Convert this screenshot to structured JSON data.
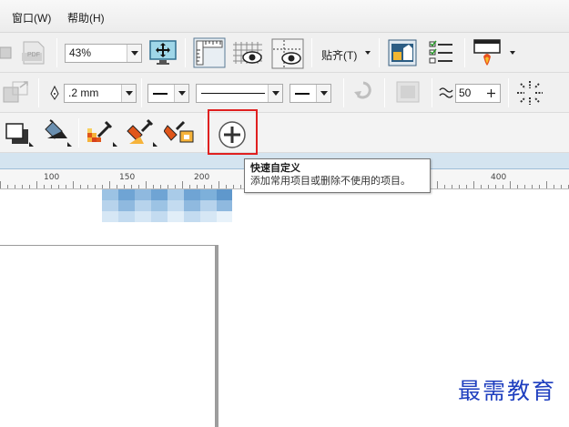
{
  "menubar": {
    "window_label": "窗口(W)",
    "help_label": "帮助(H)"
  },
  "toolbar1": {
    "zoom_value": "43%",
    "snap_label": "贴齐(T)",
    "pdf_icon_text": "PDF"
  },
  "toolbar2": {
    "outline_width": ".2 mm",
    "smoothing_value": "50"
  },
  "tooltip": {
    "title": "快速自定义",
    "description": "添加常用项目或删除不使用的项目。"
  },
  "ruler": {
    "ticks": [
      "100",
      "150",
      "200",
      "400"
    ]
  },
  "watermark": {
    "text": "最需教育"
  },
  "colors": {
    "highlight": "#e02020",
    "ruler_top": "#d4e4f0",
    "watermark": "#1f3fbf"
  }
}
